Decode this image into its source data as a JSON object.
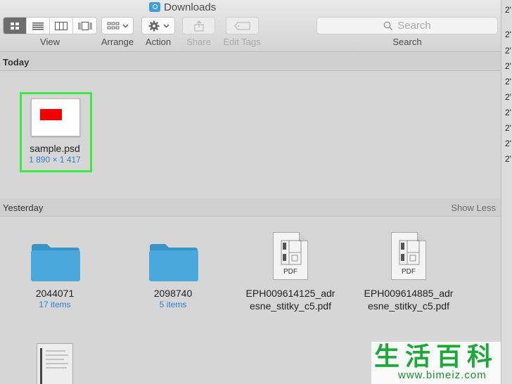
{
  "window": {
    "title": "Downloads"
  },
  "toolbar": {
    "view_label": "View",
    "arrange_label": "Arrange",
    "action_label": "Action",
    "share_label": "Share",
    "edit_tags_label": "Edit Tags",
    "search_label": "Search",
    "search_placeholder": "Search"
  },
  "sections": {
    "today": {
      "label": "Today",
      "items": [
        {
          "name": "sample.psd",
          "meta": "1 890 × 1 417"
        }
      ]
    },
    "yesterday": {
      "label": "Yesterday",
      "show_less": "Show Less",
      "items": [
        {
          "name": "2044071",
          "meta": "17 items",
          "icon": "folder-icon"
        },
        {
          "name": "2098740",
          "meta": "5 items",
          "icon": "folder-icon"
        },
        {
          "name_line1": "EPH009614125_adr",
          "name_line2": "esne_stitky_c5.pdf",
          "badge": "PDF",
          "icon": "pdf-icon"
        },
        {
          "name_line1": "EPH009614885_adr",
          "name_line2": "esne_stitky_c5.pdf",
          "badge": "PDF",
          "icon": "pdf-icon"
        }
      ]
    }
  },
  "right_strip_text": [
    "2'",
    "2'",
    "2'",
    "2'",
    "2'",
    "2'",
    "2'",
    "2'",
    "2'",
    "2'"
  ],
  "watermark": {
    "chars": [
      "生",
      "活",
      "百",
      "科"
    ],
    "url": "www.bimeiz.com"
  },
  "colors": {
    "selection": "#3fe83f",
    "folder": "#4aa8dc",
    "meta_text": "#2d7fd0"
  }
}
